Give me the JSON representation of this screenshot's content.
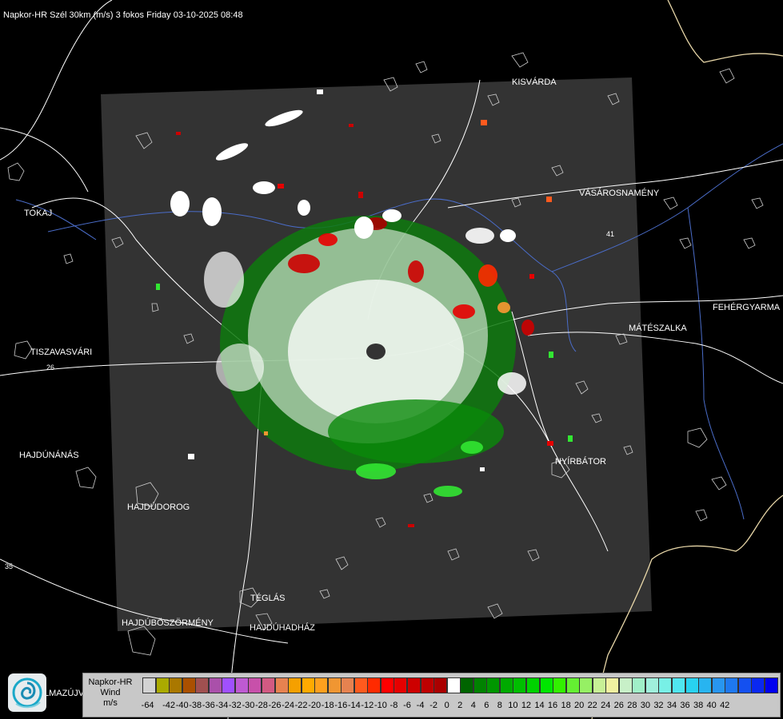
{
  "title": "Napkor-HR Szél 30km (m/s) 3 fokos Friday 03-10-2025 08:48",
  "cities": [
    {
      "id": "kisvarda",
      "name": "KISVÁRDA"
    },
    {
      "id": "vasarosnameny",
      "name": "VÁSÁROSNAMÉNY"
    },
    {
      "id": "tokaj",
      "name": "TOKAJ"
    },
    {
      "id": "fehergyarmat",
      "name": "FEHÉRGYARMA"
    },
    {
      "id": "mateszalka",
      "name": "MÁTÉSZALKA"
    },
    {
      "id": "tiszavasvari",
      "name": "TISZAVASVÁRI"
    },
    {
      "id": "hajdunanas",
      "name": "HAJDÚNÁNÁS"
    },
    {
      "id": "nyirbator",
      "name": "NYÍRBÁTOR"
    },
    {
      "id": "hajdudorog",
      "name": "HAJDÚDOROG"
    },
    {
      "id": "teglas",
      "name": "TÉGLÁS"
    },
    {
      "id": "hajduboszormeny",
      "name": "HAJDÚBÖSZÖRMÉNY"
    },
    {
      "id": "hajduhadhaz",
      "name": "HAJDÚHADHÁZ"
    },
    {
      "id": "balmazujvaros",
      "name": "LMAZÚJVÁR"
    }
  ],
  "roads": [
    "26",
    "35",
    "41"
  ],
  "legend": {
    "title_lines": [
      "Napkor-HR",
      "Wind",
      "m/s"
    ],
    "colors": [
      "#d2d2d2",
      "#aaaa00",
      "#aa7800",
      "#aa5000",
      "#a05050",
      "#aa50aa",
      "#a050ff",
      "#be5ad2",
      "#c850aa",
      "#d25a82",
      "#e68250",
      "#f5a000",
      "#ffaa00",
      "#ffa01e",
      "#f09632",
      "#e68250",
      "#ff5a1e",
      "#ff2a00",
      "#ff0000",
      "#e60000",
      "#cd0000",
      "#be0000",
      "#aa0000",
      "#ffffff",
      "#006400",
      "#008200",
      "#009600",
      "#00aa00",
      "#00be00",
      "#00d200",
      "#00e600",
      "#32f000",
      "#64f032",
      "#96f064",
      "#c8f096",
      "#f0f0a0",
      "#c8f0c8",
      "#a0f0c8",
      "#a0f0dc",
      "#78f0e6",
      "#50e6f0",
      "#28d2f0",
      "#28b4f0",
      "#2896f0",
      "#1e78f0",
      "#1450f0",
      "#0a28f0",
      "#0000f0"
    ],
    "tick_labels": [
      "-64",
      "-42",
      "-40",
      "-38",
      "-36",
      "-34",
      "-32",
      "-30",
      "-28",
      "-26",
      "-24",
      "-22",
      "-20",
      "-18",
      "-16",
      "-14",
      "-12",
      "-10",
      "-8",
      "-6",
      "-4",
      "-2",
      "0",
      "2",
      "4",
      "6",
      "8",
      "10",
      "12",
      "14",
      "16",
      "18",
      "20",
      "22",
      "24",
      "26",
      "28",
      "30",
      "32",
      "34",
      "36",
      "38",
      "40",
      "42"
    ]
  }
}
